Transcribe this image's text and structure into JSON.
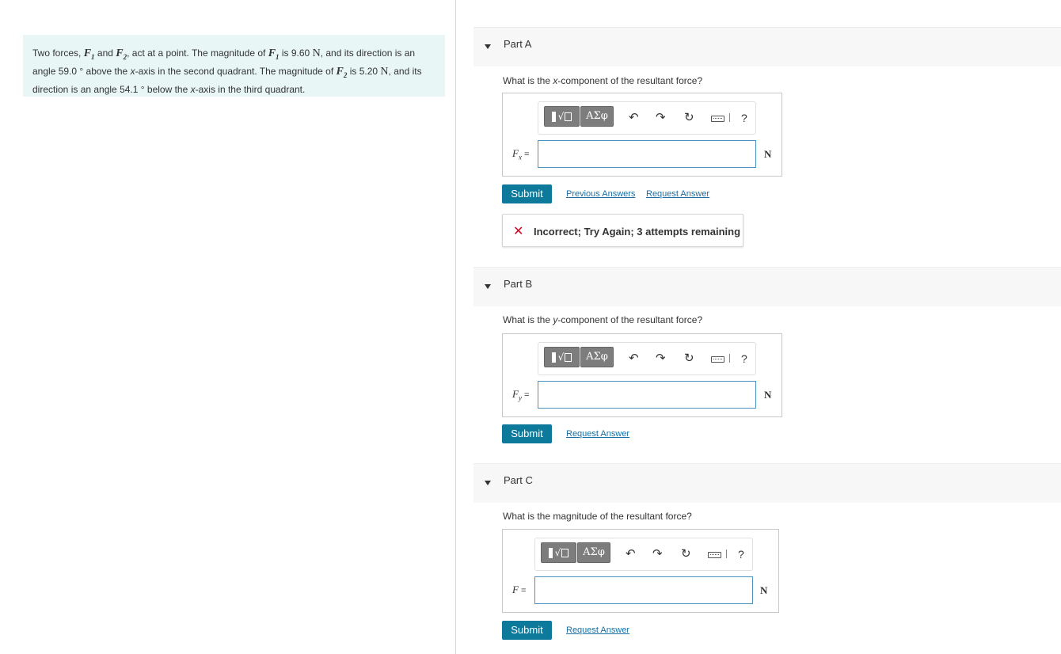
{
  "problem": {
    "t1": "Two forces,",
    "f1": "F",
    "f1_sub": "1",
    "t2": "and",
    "f2": "F",
    "f2_sub": "2",
    "t3": ", act at a point. The magnitude of",
    "t4": "is 9.60",
    "unit_n": "N",
    "t5": ", and its direction is an angle 59.0 ° above the",
    "xaxis": "x",
    "t6": "-axis in the second quadrant. The magnitude of",
    "t7": "is 5.20",
    "t8": ", and its direction is an angle 54.1 ° below the",
    "t9": "-axis in the third quadrant."
  },
  "parts": [
    {
      "title": "Part A",
      "question_pre": "What is the ",
      "question_var": "x",
      "question_post": "-component of the resultant force?",
      "label": "F",
      "label_sub": "x",
      "label_eq": " =",
      "unit": "N",
      "input_value": "",
      "submit": "Submit",
      "links": [
        "Previous Answers",
        "Request Answer"
      ],
      "feedback": "Incorrect; Try Again; 3 attempts remaining"
    },
    {
      "title": "Part B",
      "question_pre": "What is the ",
      "question_var": "y",
      "question_post": "-component of the resultant force?",
      "label": "F",
      "label_sub": "y",
      "label_eq": " =",
      "unit": "N",
      "input_value": "",
      "submit": "Submit",
      "links": [
        "Request Answer"
      ]
    },
    {
      "title": "Part C",
      "question_pre": "What is the magnitude of the resultant force?",
      "label": "F",
      "label_eq": " =",
      "unit": "N",
      "input_value": "",
      "submit": "Submit",
      "links": [
        "Request Answer"
      ]
    }
  ],
  "toolbar": {
    "greek_label": "ΑΣφ",
    "template_label": "√",
    "undo_icon": "↶",
    "redo_icon": "↷",
    "reset_icon": "↻",
    "help_label": "?"
  },
  "icons": [
    "template-icon",
    "greek-symbols-icon",
    "undo-icon",
    "redo-icon",
    "reset-icon",
    "keyboard-icon",
    "help-icon",
    "incorrect-x-icon",
    "collapse-triangle-icon"
  ],
  "colors": {
    "problem_bg": "#e8f6f6",
    "submit_bg": "#0d7a9c",
    "link": "#1a6fa3",
    "incorrect": "#d0021b",
    "input_border": "#4a90c2"
  }
}
